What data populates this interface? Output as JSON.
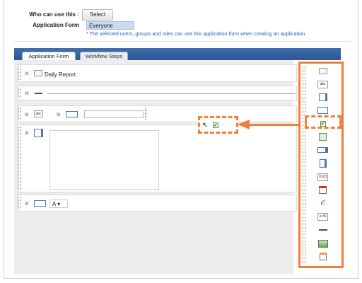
{
  "header": {
    "who_label": "Who can use this :",
    "select_label": "Select",
    "form_label": "Application Form",
    "everyone_value": "Everyone",
    "note": "* The selected users, groups and roles can use this application form when creating an application."
  },
  "tabs": [
    {
      "label": "Application Form"
    },
    {
      "label": "Workflow Steps"
    }
  ],
  "rows": {
    "daily_report": "Daily Report",
    "type_value": "A"
  },
  "palette": {
    "items": [
      "label-icon",
      "abc-text-icon",
      "textarea-icon",
      "input-field-icon",
      "checkbox-icon",
      "image-field-icon",
      "dropdown-icon",
      "list-icon",
      "number-icon",
      "date-icon",
      "attachment-icon",
      "formula-icon",
      "line-icon",
      "picture-icon",
      "checklist-icon"
    ],
    "number_text": "0123",
    "formula_text": "x+%",
    "abc_text": "abc"
  },
  "colors": {
    "accent": "#f07f3c",
    "tab_bar": "#2c5592",
    "note": "#2461b0"
  }
}
